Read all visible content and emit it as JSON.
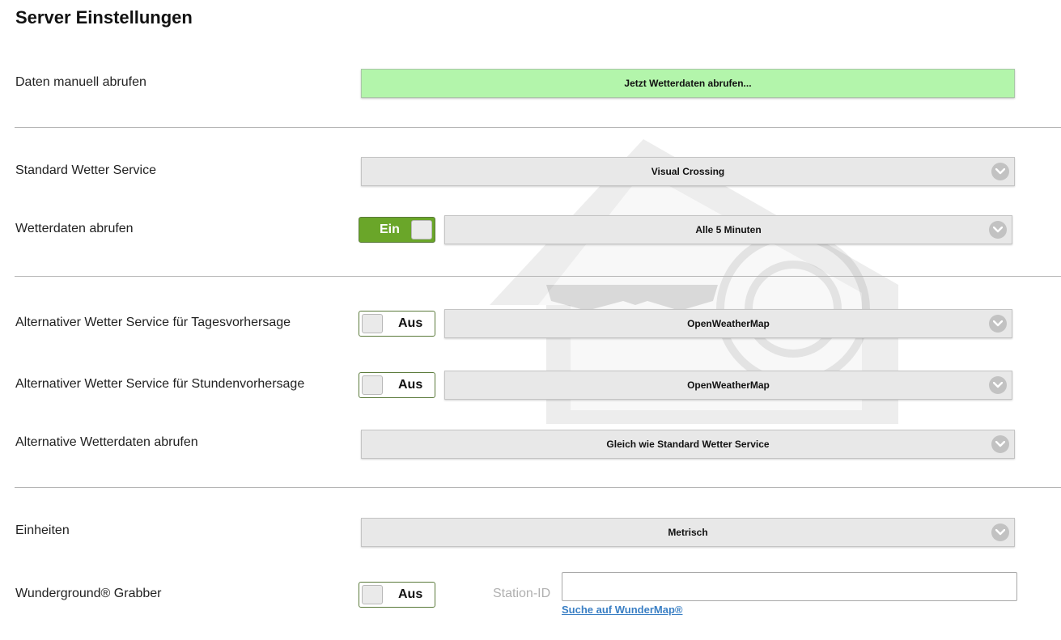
{
  "page": {
    "title": "Server Einstellungen"
  },
  "manual_fetch": {
    "label": "Daten manuell abrufen",
    "button_label": "Jetzt Wetterdaten abrufen...",
    "button_color": "#b3f5ab"
  },
  "standard_service": {
    "label": "Standard Wetter Service",
    "value": "Visual Crossing"
  },
  "fetch_weather": {
    "label": "Wetterdaten abrufen",
    "toggle": "Ein",
    "interval": "Alle 5 Minuten"
  },
  "alt_daily": {
    "label": "Alternativer Wetter Service für Tagesvorhersage",
    "toggle": "Aus",
    "value": "OpenWeatherMap"
  },
  "alt_hourly": {
    "label": "Alternativer Wetter Service für Stundenvorhersage",
    "toggle": "Aus",
    "value": "OpenWeatherMap"
  },
  "alt_fetch": {
    "label": "Alternative Wetterdaten abrufen",
    "value": "Gleich wie Standard Wetter Service"
  },
  "units": {
    "label": "Einheiten",
    "value": "Metrisch"
  },
  "wunderground": {
    "label": "Wunderground® Grabber",
    "toggle": "Aus",
    "station_label": "Station-ID",
    "station_value": "",
    "link": "Suche auf WunderMap®"
  },
  "colors": {
    "toggle_on": "#6aa629",
    "link": "#3a7fc4",
    "select_bg": "#e8e8e8"
  },
  "icons": {
    "select_arrow": "chevron-down-icon",
    "watermark": "house-logo-watermark"
  }
}
